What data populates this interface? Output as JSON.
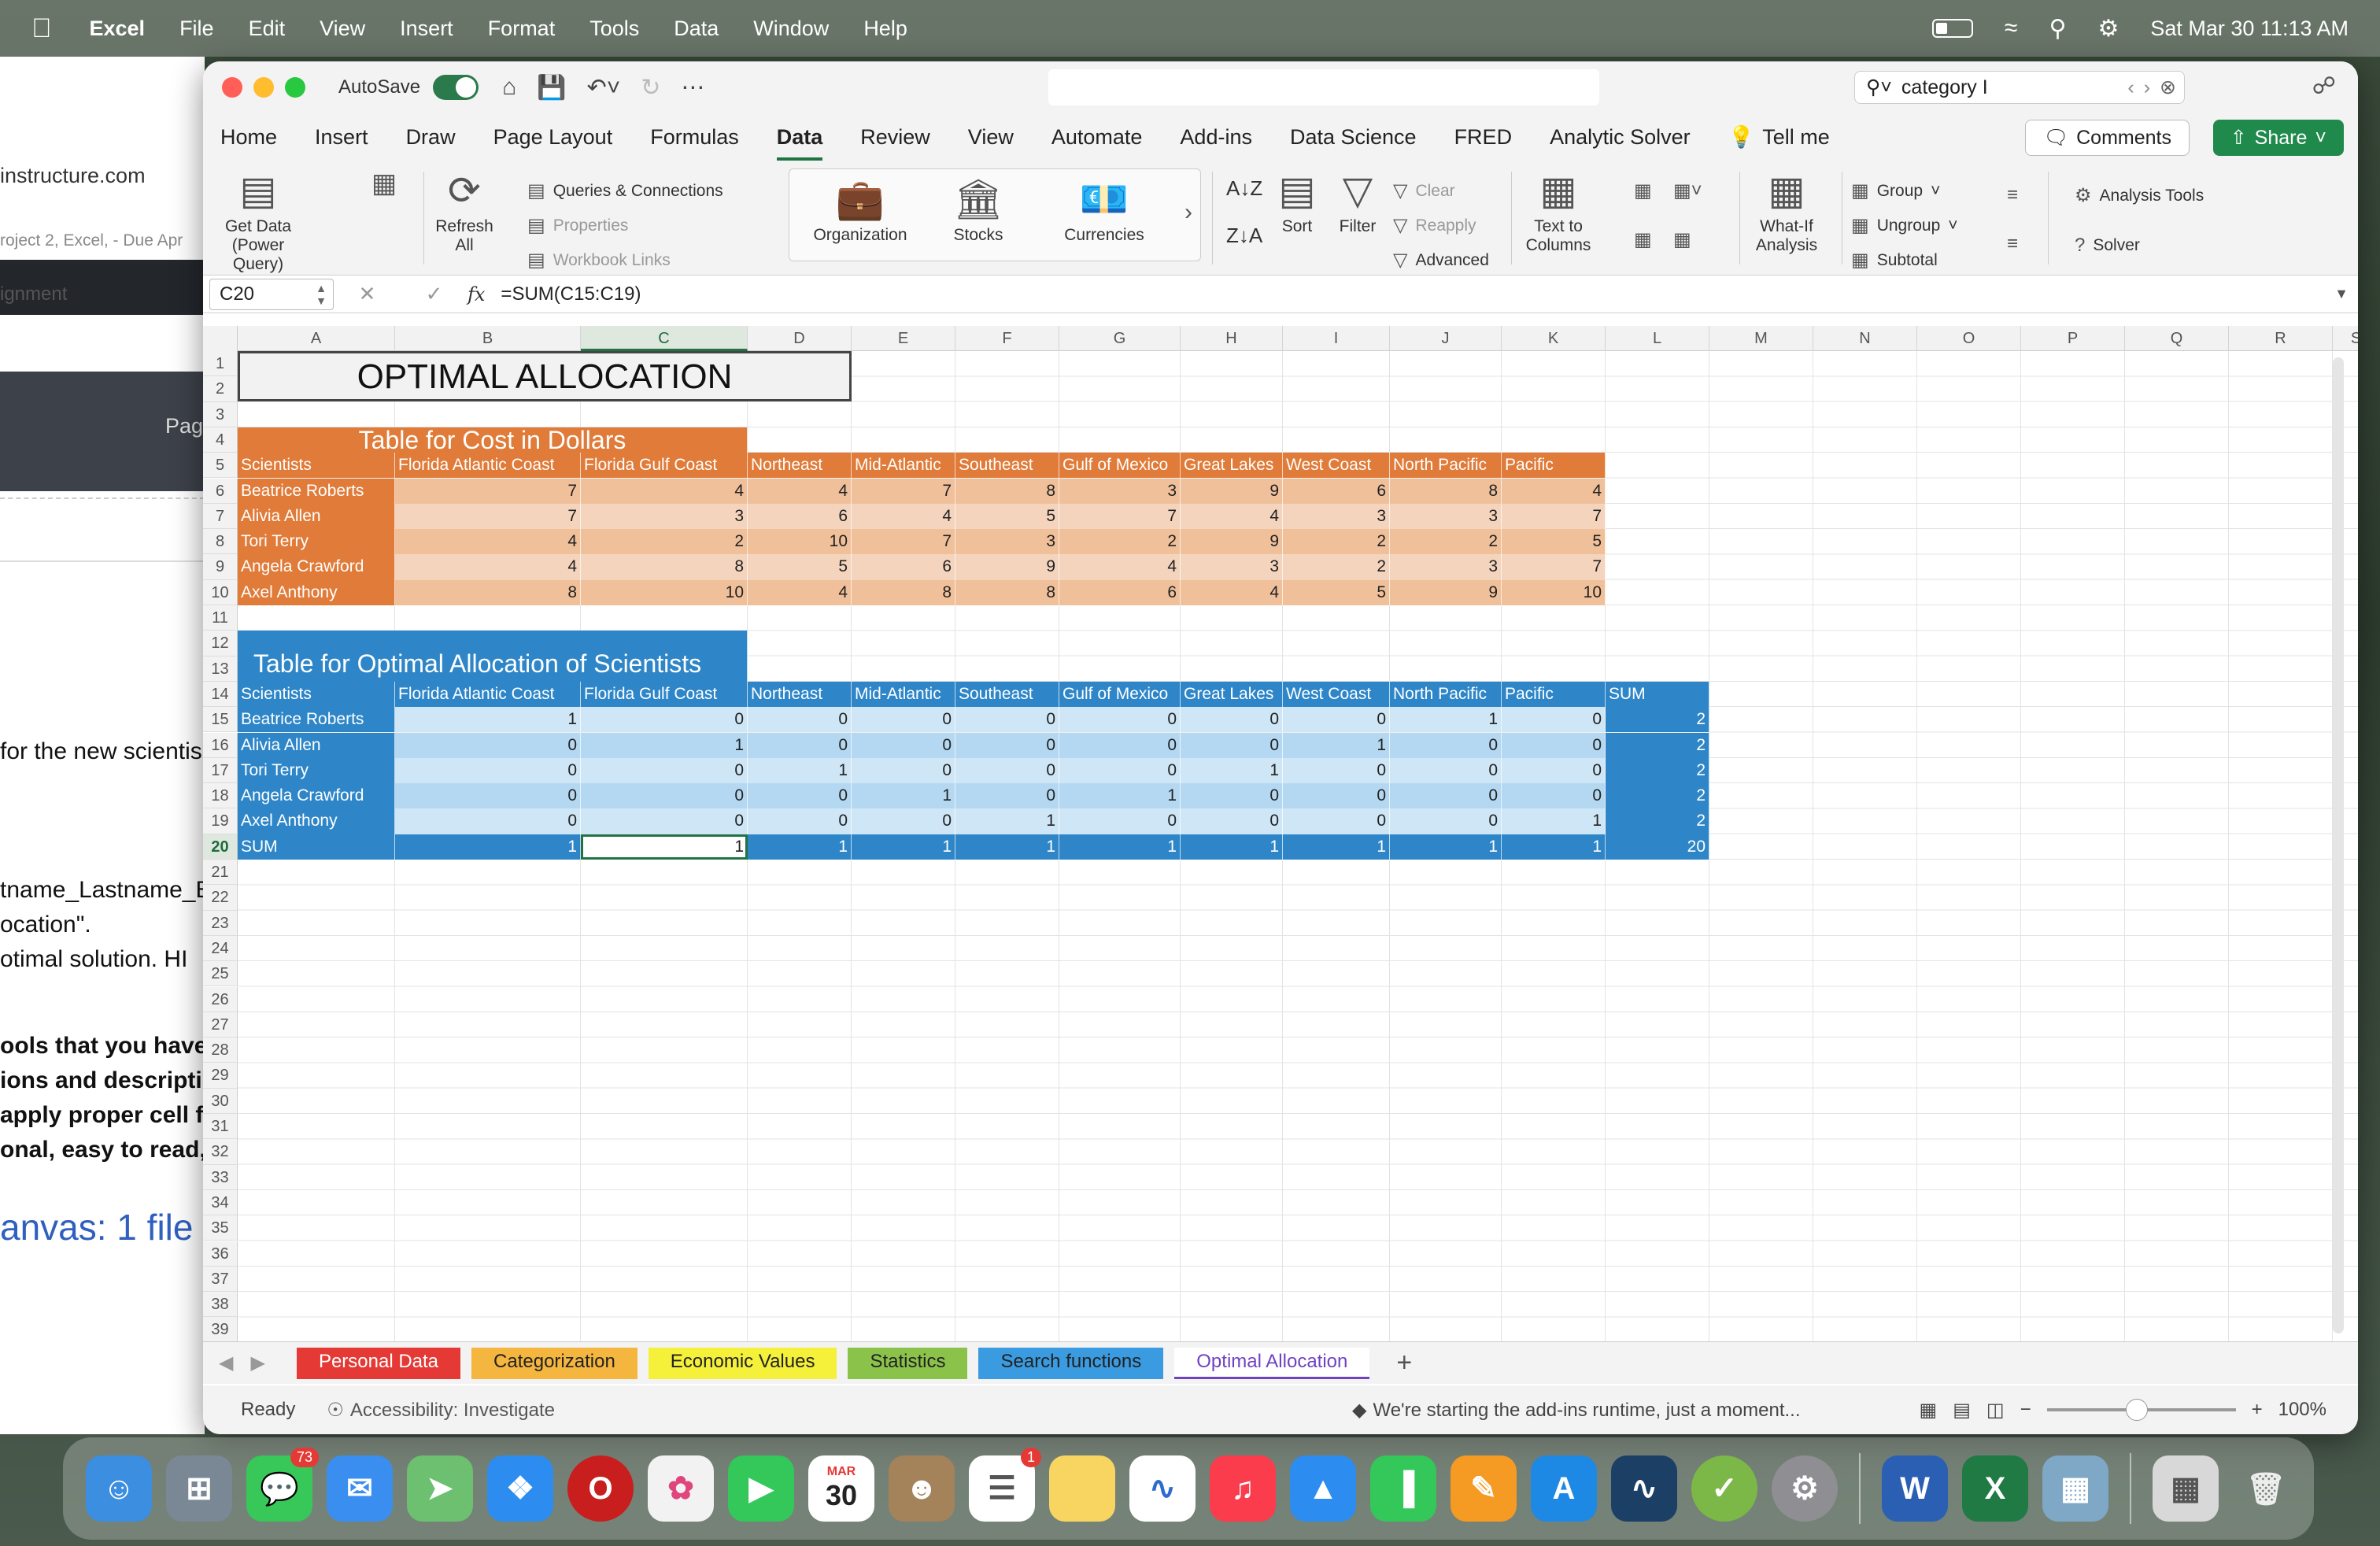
{
  "menubar": {
    "app": "Excel",
    "items": [
      "File",
      "Edit",
      "View",
      "Insert",
      "Format",
      "Tools",
      "Data",
      "Window",
      "Help"
    ],
    "datetime": "Sat Mar 30  11:13 AM"
  },
  "bgdoc": {
    "url": "instructure.com",
    "breadcrumb": "roject 2, Excel, - Due Apr",
    "dark_label": "Pag",
    "tail1": "ignment",
    "lines": [
      "for the new scientis",
      "tname_Lastname_E",
      "ocation\".",
      "otimal solution.  HI",
      "ools that you have",
      "ions and descriptio",
      "apply proper cell fo",
      "onal, easy to read, a",
      "anvas: 1 file"
    ]
  },
  "window": {
    "autosave": "AutoSave",
    "search_value": "category I"
  },
  "ribbon_tabs": [
    "Home",
    "Insert",
    "Draw",
    "Page Layout",
    "Formulas",
    "Data",
    "Review",
    "View",
    "Automate",
    "Add-ins",
    "Data Science",
    "FRED",
    "Analytic Solver",
    "Tell me"
  ],
  "active_tab": "Data",
  "buttons": {
    "comments": "Comments",
    "share": "Share"
  },
  "ribbon": {
    "get_data": "Get Data (Power Query)",
    "refresh": "Refresh All",
    "queries": "Queries & Connections",
    "properties": "Properties",
    "workbook_links": "Workbook Links",
    "organization": "Organization",
    "stocks": "Stocks",
    "currencies": "Currencies",
    "sort": "Sort",
    "filter": "Filter",
    "clear": "Clear",
    "reapply": "Reapply",
    "advanced": "Advanced",
    "text_to_columns": "Text to Columns",
    "what_if": "What-If Analysis",
    "group": "Group",
    "ungroup": "Ungroup",
    "subtotal": "Subtotal",
    "analysis_tools": "Analysis Tools",
    "solver": "Solver"
  },
  "formula_bar": {
    "name_box": "C20",
    "formula": "=SUM(C15:C19)"
  },
  "columns": [
    "A",
    "B",
    "C",
    "D",
    "E",
    "F",
    "G",
    "H",
    "I",
    "J",
    "K",
    "L",
    "M",
    "N",
    "O",
    "P",
    "Q",
    "R",
    "S"
  ],
  "rows": [
    "1",
    "2",
    "3",
    "4",
    "5",
    "6",
    "7",
    "8",
    "9",
    "10",
    "11",
    "12",
    "13",
    "14",
    "15",
    "16",
    "17",
    "18",
    "19",
    "20",
    "21",
    "22",
    "23",
    "24",
    "25",
    "26",
    "27",
    "28",
    "29",
    "30",
    "31",
    "32",
    "33",
    "34",
    "35",
    "36",
    "37",
    "38",
    "39"
  ],
  "sheet": {
    "title": "OPTIMAL ALLOCATION",
    "cost_table_title": "Table for Cost in Dollars",
    "alloc_table_title": "Table for Optimal Allocation of Scientists",
    "headers": [
      "Scientists",
      "Florida Atlantic Coast",
      "Florida Gulf Coast",
      "Northeast",
      "Mid-Atlantic",
      "Southeast",
      "Gulf of Mexico",
      "Great Lakes",
      "West Coast",
      "North Pacific",
      "Pacific"
    ],
    "sum_label": "SUM",
    "cost_rows": [
      {
        "name": "Beatrice Roberts",
        "v": [
          "7",
          "4",
          "4",
          "7",
          "8",
          "3",
          "9",
          "6",
          "8",
          "4"
        ]
      },
      {
        "name": "Alivia Allen",
        "v": [
          "7",
          "3",
          "6",
          "4",
          "5",
          "7",
          "4",
          "3",
          "3",
          "7"
        ]
      },
      {
        "name": "Tori Terry",
        "v": [
          "4",
          "2",
          "10",
          "7",
          "3",
          "2",
          "9",
          "2",
          "2",
          "5"
        ]
      },
      {
        "name": "Angela Crawford",
        "v": [
          "4",
          "8",
          "5",
          "6",
          "9",
          "4",
          "3",
          "2",
          "3",
          "7"
        ]
      },
      {
        "name": "Axel Anthony",
        "v": [
          "8",
          "10",
          "4",
          "8",
          "8",
          "6",
          "4",
          "5",
          "9",
          "10"
        ]
      }
    ],
    "alloc_rows": [
      {
        "name": "Beatrice Roberts",
        "v": [
          "1",
          "0",
          "0",
          "0",
          "0",
          "0",
          "0",
          "0",
          "1",
          "0"
        ],
        "sum": "2"
      },
      {
        "name": "Alivia Allen",
        "v": [
          "0",
          "1",
          "0",
          "0",
          "0",
          "0",
          "0",
          "1",
          "0",
          "0"
        ],
        "sum": "2"
      },
      {
        "name": "Tori Terry",
        "v": [
          "0",
          "0",
          "1",
          "0",
          "0",
          "0",
          "1",
          "0",
          "0",
          "0"
        ],
        "sum": "2"
      },
      {
        "name": "Angela Crawford",
        "v": [
          "0",
          "0",
          "0",
          "1",
          "0",
          "1",
          "0",
          "0",
          "0",
          "0"
        ],
        "sum": "2"
      },
      {
        "name": "Axel Anthony",
        "v": [
          "0",
          "0",
          "0",
          "0",
          "1",
          "0",
          "0",
          "0",
          "0",
          "1"
        ],
        "sum": "2"
      }
    ],
    "sum_row": {
      "v": [
        "1",
        "1",
        "1",
        "1",
        "1",
        "1",
        "1",
        "1",
        "1",
        "1"
      ],
      "total": "20"
    }
  },
  "sheet_tabs": [
    {
      "label": "Personal Data",
      "color": "#e53935",
      "text": "#ffffff"
    },
    {
      "label": "Categorization",
      "color": "#f4b63f",
      "text": "#222222"
    },
    {
      "label": "Economic Values",
      "color": "#f5f03a",
      "text": "#222222"
    },
    {
      "label": "Statistics",
      "color": "#8bc34a",
      "text": "#222222"
    },
    {
      "label": "Search functions",
      "color": "#3a9be0",
      "text": "#222222"
    },
    {
      "label": "Optimal Allocation",
      "color": "#ffffff",
      "text": "#6f42c1"
    }
  ],
  "status": {
    "ready": "Ready",
    "accessibility": "Accessibility: Investigate",
    "addins": "We're starting the add-ins runtime, just a moment...",
    "zoom": "100%"
  },
  "dock": {
    "messages_badge": "73",
    "reminders_badge": "1",
    "calendar_month": "MAR",
    "calendar_day": "30"
  }
}
